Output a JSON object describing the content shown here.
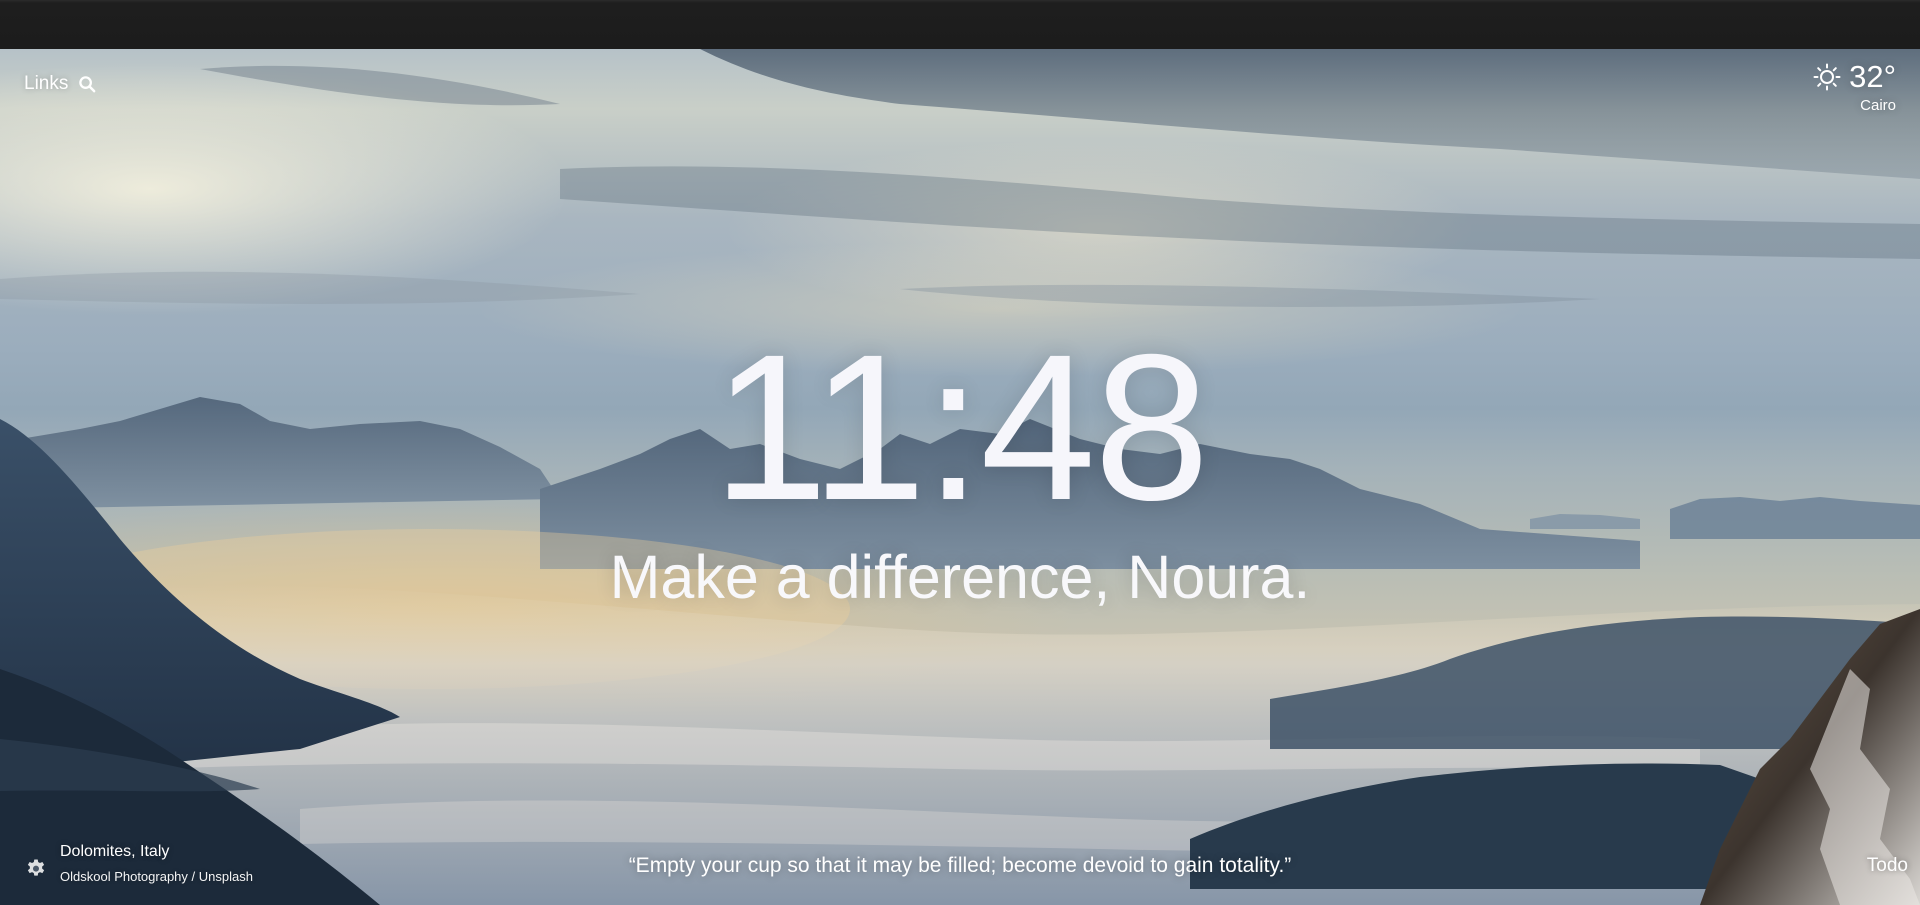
{
  "links": {
    "label": "Links",
    "icon": "search-icon"
  },
  "weather": {
    "icon": "sun-icon",
    "temperature": "32°",
    "city": "Cairo"
  },
  "clock": {
    "time": "11:48"
  },
  "greeting": {
    "text": "Make a difference, Noura."
  },
  "background_info": {
    "location": "Dolomites, Italy",
    "credit": "Oldskool Photography / Unsplash",
    "settings_icon": "gear-icon"
  },
  "quote": {
    "text": "“Empty your cup so that it may be filled; become devoid to gain totality.”"
  },
  "todo": {
    "label": "Todo"
  }
}
